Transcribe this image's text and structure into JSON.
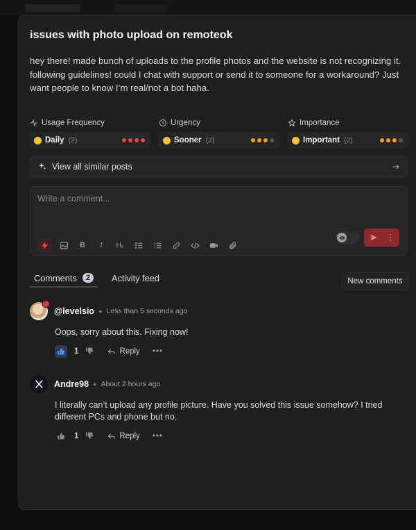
{
  "post": {
    "title": "issues with photo upload on remoteok",
    "body": "hey there! made bunch of uploads to the profile photos and the website is not recognizing it. following guidelines! could I chat with support or send it to someone for a workaround? Just want people to know I’m real/not a bot haha."
  },
  "metrics": [
    {
      "label": "Usage Frequency",
      "icon": "activity-icon",
      "value": "Daily",
      "count": "(2)",
      "level": 4,
      "max": 4,
      "color": "#e5484d"
    },
    {
      "label": "Urgency",
      "icon": "clock-icon",
      "value": "Sooner",
      "count": "(2)",
      "level": 3,
      "max": 4,
      "color": "#f59e2b"
    },
    {
      "label": "Importance",
      "icon": "star-icon",
      "value": "Important",
      "count": "(2)",
      "level": 3,
      "max": 4,
      "color": "#f59e2b"
    }
  ],
  "similar": {
    "label": "View all similar posts"
  },
  "composer": {
    "placeholder": "Write a comment...",
    "tools": [
      "bolt-icon",
      "image-icon",
      "bold-icon",
      "italic-icon",
      "heading-icon",
      "bullet-list-icon",
      "numbered-list-icon",
      "link-icon",
      "code-icon",
      "video-icon",
      "attachment-icon"
    ],
    "send_color": "#8e2a2e"
  },
  "tabs": {
    "comments_label": "Comments",
    "comments_count": "2",
    "activity_label": "Activity feed",
    "new_comments_label": "New comments"
  },
  "comments": [
    {
      "author": "@levelsio",
      "time": "Less than 5 seconds ago",
      "text": "Oops, sorry about this. Fixing now!",
      "likes": "1",
      "liked": true,
      "reply_label": "Reply"
    },
    {
      "author": "Andre98",
      "time": "About 2 hours ago",
      "text": "I literally can’t upload any profile picture. Have you solved this issue somehow? I tried different PCs and phone but no.",
      "likes": "1",
      "liked": false,
      "reply_label": "Reply"
    }
  ]
}
